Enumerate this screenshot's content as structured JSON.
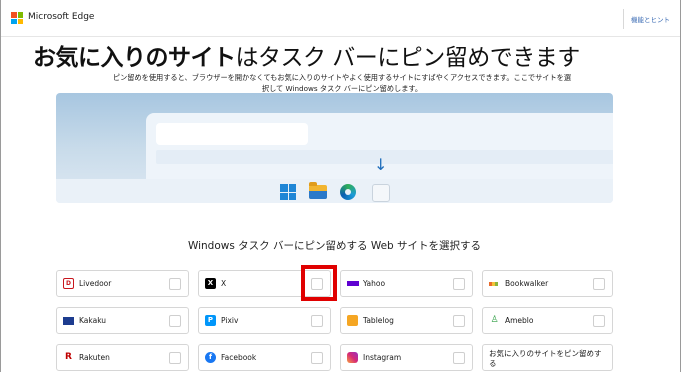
{
  "header": {
    "brand": "Microsoft Edge",
    "tips_link": "機能とヒント"
  },
  "hero": {
    "headline_bold": "お気に入りのサイト",
    "headline_rest": "はタスク バーにピン留めできます",
    "subtext": "ピン留めを使用すると、ブラウザーを開かなくてもお気に入りのサイトやよく使用するサイトにすばやくアクセスできます。ここでサイトを選択して Windows タスク バーにピン留めします。"
  },
  "section": {
    "title": "Windows タスク バーにピン留めする Web サイトを選択する"
  },
  "sites": [
    {
      "label": "Livedoor",
      "icon": "livedoor-icon",
      "checked": false
    },
    {
      "label": "X",
      "icon": "x-icon",
      "checked": false
    },
    {
      "label": "Yahoo",
      "icon": "yahoo-icon",
      "checked": false
    },
    {
      "label": "Bookwalker",
      "icon": "bookwalker-icon",
      "checked": false
    },
    {
      "label": "Kakaku",
      "icon": "kakaku-icon",
      "checked": false
    },
    {
      "label": "Pixiv",
      "icon": "pixiv-icon",
      "checked": false
    },
    {
      "label": "Tablelog",
      "icon": "tablelog-icon",
      "checked": false
    },
    {
      "label": "Ameblo",
      "icon": "ameblo-icon",
      "checked": false
    },
    {
      "label": "Rakuten",
      "icon": "rakuten-icon",
      "checked": false
    },
    {
      "label": "Facebook",
      "icon": "facebook-icon",
      "checked": false
    },
    {
      "label": "Instagram",
      "icon": "instagram-icon",
      "checked": false
    },
    {
      "label": "お気に入りのサイトをピン留めする",
      "icon": "",
      "checked": false
    }
  ],
  "colors": {
    "accent_link": "#3d6db5",
    "highlight": "#e00000",
    "taskbar_arrow": "#1f6dbb"
  }
}
